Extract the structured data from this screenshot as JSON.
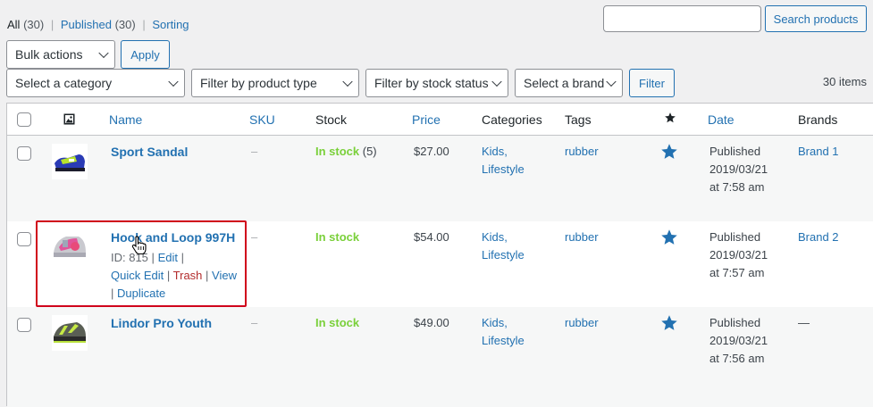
{
  "views": {
    "all_label": "All",
    "all_count": "(30)",
    "published_label": "Published",
    "published_count": "(30)",
    "sorting_label": "Sorting",
    "separator": "|"
  },
  "search": {
    "value": "",
    "placeholder": "",
    "button_label": "Search products"
  },
  "bulk": {
    "selected": "Bulk actions",
    "apply_label": "Apply"
  },
  "filters": {
    "category": "Select a category",
    "product_type": "Filter by product type",
    "stock_status": "Filter by stock status",
    "brand": "Select a brand",
    "button_label": "Filter"
  },
  "items_count": "30 items",
  "columns": {
    "thumb_icon": "image-icon",
    "name": "Name",
    "sku": "SKU",
    "stock": "Stock",
    "price": "Price",
    "categories": "Categories",
    "tags": "Tags",
    "featured_icon": "star-icon",
    "date": "Date",
    "brands": "Brands"
  },
  "rows": [
    {
      "name": "Sport Sandal",
      "sku": "–",
      "stock": "In stock",
      "stock_count": "(5)",
      "price": "$27.00",
      "categories": [
        "Kids,",
        "Lifestyle"
      ],
      "tags": "rubber",
      "date_status": "Published",
      "date_day": "2019/03/21",
      "date_time": "at 7:58 am",
      "brand": "Brand 1"
    },
    {
      "name": "Hook and Loop 997H",
      "sku": "–",
      "stock": "In stock",
      "stock_count": "",
      "price": "$54.00",
      "categories": [
        "Kids,",
        "Lifestyle"
      ],
      "tags": "rubber",
      "date_status": "Published",
      "date_day": "2019/03/21",
      "date_time": "at 7:57 am",
      "brand": "Brand 2",
      "row_actions": {
        "id": "ID: 815",
        "edit": "Edit",
        "quick_edit": "Quick Edit",
        "trash": "Trash",
        "view": "View",
        "duplicate": "Duplicate",
        "sep": "|"
      }
    },
    {
      "name": "Lindor Pro Youth",
      "sku": "–",
      "stock": "In stock",
      "stock_count": "",
      "price": "$49.00",
      "categories": [
        "Kids,",
        "Lifestyle"
      ],
      "tags": "rubber",
      "date_status": "Published",
      "date_day": "2019/03/21",
      "date_time": "at 7:56 am",
      "brand": "—"
    }
  ],
  "colors": {
    "link": "#2271b1",
    "in_stock": "#7ad03a",
    "trash": "#b32d2e",
    "highlight_box": "#d0021b",
    "star": "#2271b1"
  }
}
